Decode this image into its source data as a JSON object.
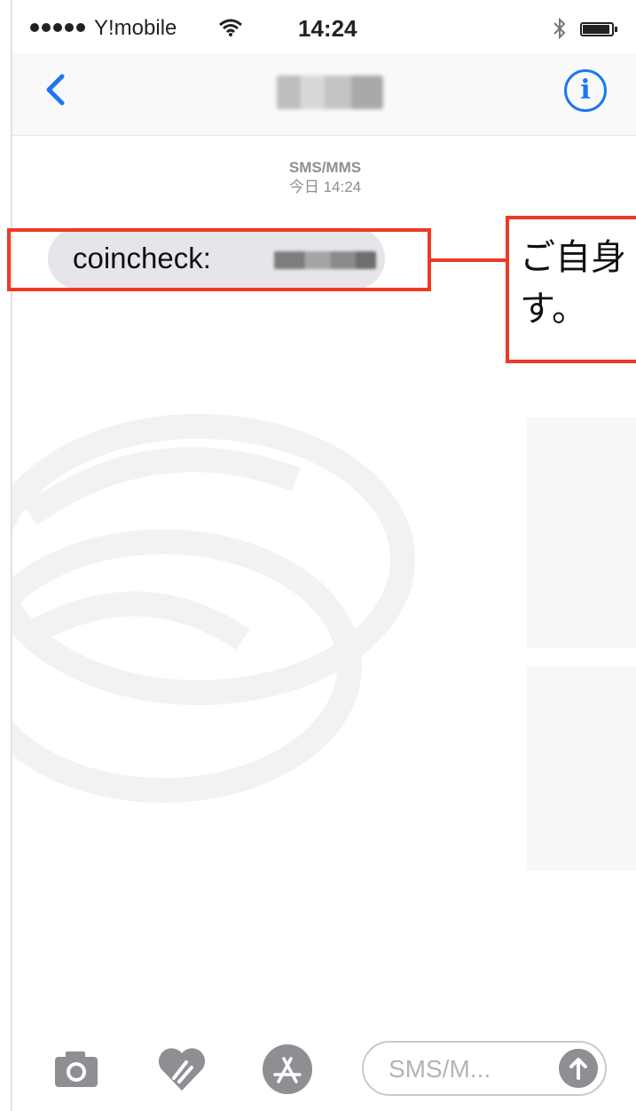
{
  "status_bar": {
    "carrier": "Y!mobile",
    "time": "14:24",
    "wifi_icon": "wifi-icon",
    "bluetooth_icon": "bluetooth-icon",
    "battery_icon": "battery-icon"
  },
  "nav_bar": {
    "back_icon": "chevron-left-icon",
    "contact_name": "",
    "info_icon": "info-icon",
    "accent_color": "#1a78f2"
  },
  "thread": {
    "service": "SMS/MMS",
    "timestamp": "今日 14:24",
    "messages": [
      {
        "text": "coincheck:",
        "direction": "incoming",
        "bubble_color": "#e5e5ea"
      }
    ]
  },
  "input_bar": {
    "camera_icon": "camera-icon",
    "digital_touch_icon": "digital-touch-icon",
    "app_store_icon": "app-store-icon",
    "placeholder": "SMS/M...",
    "send_icon": "arrow-up-icon"
  },
  "annotation": {
    "callout_text": "ご自身\nす。",
    "border_color": "#ee3a24"
  }
}
